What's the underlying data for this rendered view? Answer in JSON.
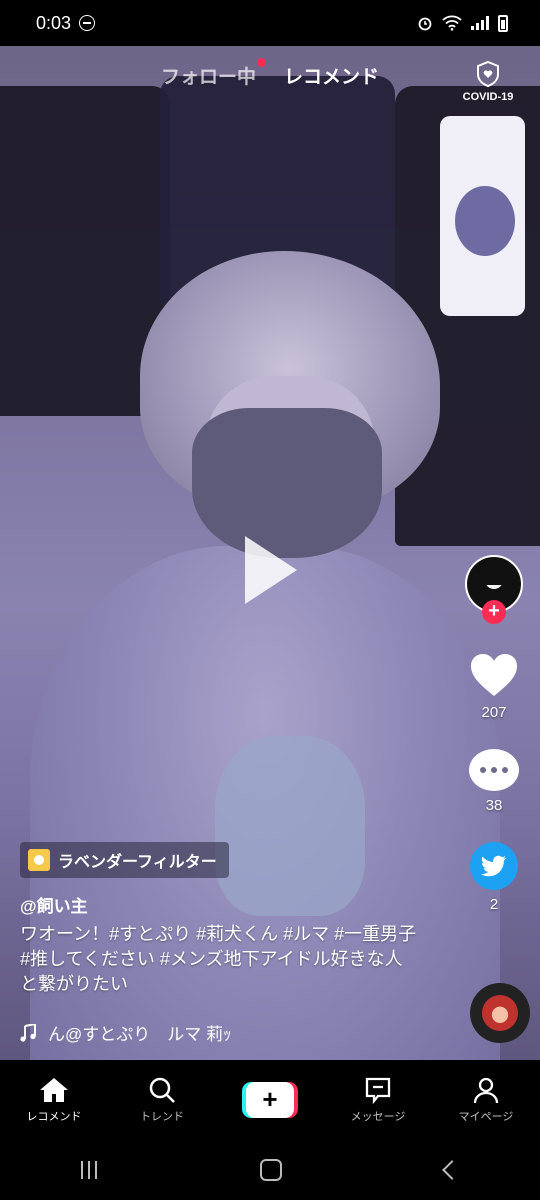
{
  "status_bar": {
    "time": "0:03"
  },
  "top": {
    "tab_following": "フォロー中",
    "tab_recommend": "レコメンド",
    "covid_label": "COVID-19"
  },
  "rail": {
    "likes": "207",
    "comments": "38",
    "shares": "2"
  },
  "post": {
    "filter": "ラベンダーフィルター",
    "username": "@飼い主",
    "caption": "ワオーン！#すとぷり #莉犬くん #ルマ #一重男子 #推してください #メンズ地下アイドル好きな人と繋がりたい",
    "sound": "ん@すとぷり　ルマ 莉ｯ"
  },
  "nav": {
    "home": "レコメンド",
    "discover": "トレンド",
    "inbox": "メッセージ",
    "profile": "マイページ"
  },
  "colors": {
    "accent": "#fe2c55",
    "cyan": "#25f4ee",
    "twitter": "#1da1f2"
  }
}
